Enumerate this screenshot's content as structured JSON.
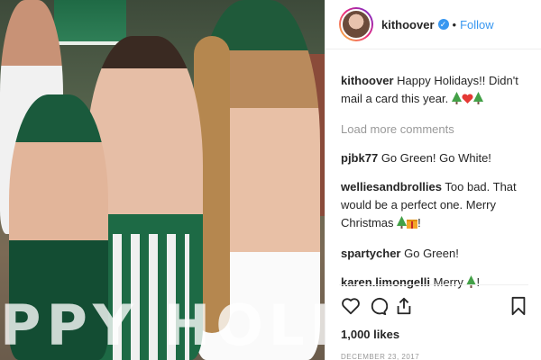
{
  "photo": {
    "overlay_text": "PPY HOLIDAYS"
  },
  "header": {
    "username": "kithoover",
    "verified_mark": "✓",
    "separator": "•",
    "follow_label": "Follow"
  },
  "caption": {
    "user": "kithoover",
    "text": "Happy Holidays!! Didn't mail a card this year.",
    "emojis": [
      "tree",
      "heart",
      "tree"
    ]
  },
  "load_more": "Load more comments",
  "comments": [
    {
      "user": "pjbk77",
      "text": "Go Green! Go White!"
    },
    {
      "user": "welliesandbrollies",
      "text": "Too bad. That would be a perfect one. Merry Christmas",
      "emojis": [
        "tree",
        "gift"
      ],
      "suffix": "!"
    },
    {
      "user": "spartycher",
      "text": "Go Green!"
    },
    {
      "user": "karen.limongelli",
      "text": "Merry",
      "emojis": [
        "tree"
      ],
      "suffix": "!"
    }
  ],
  "likes": "1,000 likes",
  "date": "DECEMBER 23, 2017",
  "icons": [
    "heart-icon",
    "comment-icon",
    "share-icon",
    "bookmark-icon"
  ]
}
